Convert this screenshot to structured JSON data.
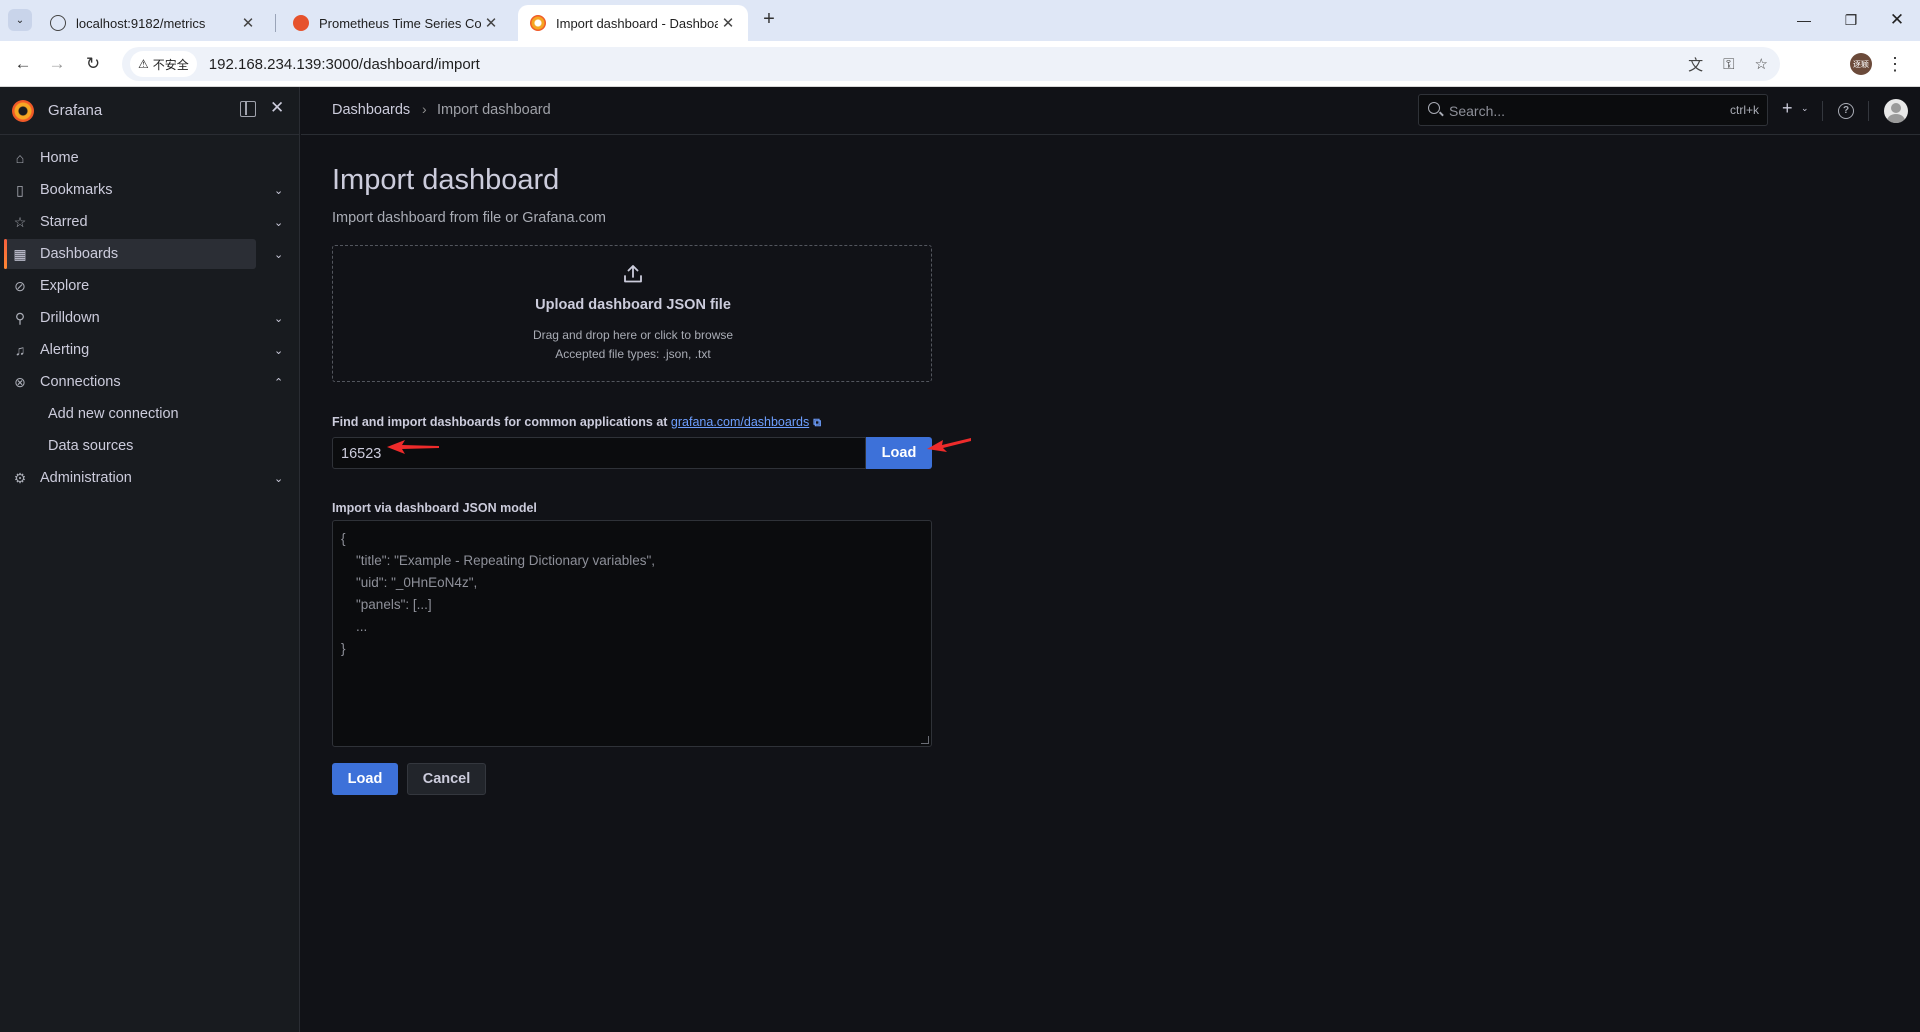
{
  "browser": {
    "tabs": [
      {
        "title": "localhost:9182/metrics",
        "favicon": "globe-icon"
      },
      {
        "title": "Prometheus Time Series Colle",
        "favicon": "prometheus-icon"
      },
      {
        "title": "Import dashboard - Dashboa",
        "favicon": "grafana-icon",
        "active": true
      }
    ],
    "security_label": "不安全",
    "url": "192.168.234.139:3000/dashboard/import",
    "profile_initials": "逐颖"
  },
  "sidebar": {
    "brand": "Grafana",
    "items": [
      {
        "label": "Home",
        "icon": "home-icon"
      },
      {
        "label": "Bookmarks",
        "icon": "bookmark-icon",
        "expandable": true
      },
      {
        "label": "Starred",
        "icon": "star-icon",
        "expandable": true
      },
      {
        "label": "Dashboards",
        "icon": "dashboards-icon",
        "expandable": true,
        "active": true
      },
      {
        "label": "Explore",
        "icon": "compass-icon"
      },
      {
        "label": "Drilldown",
        "icon": "drilldown-icon",
        "expandable": true
      },
      {
        "label": "Alerting",
        "icon": "bell-icon",
        "expandable": true
      },
      {
        "label": "Connections",
        "icon": "connections-icon",
        "expanded": true
      },
      {
        "label": "Add new connection",
        "sub": true
      },
      {
        "label": "Data sources",
        "sub": true
      },
      {
        "label": "Administration",
        "icon": "gear-icon",
        "expandable": true
      }
    ]
  },
  "topbar": {
    "breadcrumb": [
      "Dashboards",
      "Import dashboard"
    ],
    "search_placeholder": "Search...",
    "search_shortcut": "ctrl+k"
  },
  "main": {
    "title": "Import dashboard",
    "subtitle": "Import dashboard from file or Grafana.com",
    "upload": {
      "title": "Upload dashboard JSON file",
      "hint": "Drag and drop here or click to browse",
      "types": "Accepted file types: .json, .txt"
    },
    "gcom": {
      "label_prefix": "Find and import dashboards for common applications at ",
      "link_text": "grafana.com/dashboards",
      "input_value": "16523",
      "load_label": "Load"
    },
    "json_model": {
      "label": "Import via dashboard JSON model",
      "placeholder": "{\n    \"title\": \"Example - Repeating Dictionary variables\",\n    \"uid\": \"_0HnEoN4z\",\n    \"panels\": [...]\n    ...\n}"
    },
    "buttons": {
      "load": "Load",
      "cancel": "Cancel"
    }
  },
  "colors": {
    "primary": "#3d71d9",
    "annotation_arrow": "#ee2b2b",
    "link": "#6e9fff",
    "grafana_orange": "#f05a28"
  }
}
